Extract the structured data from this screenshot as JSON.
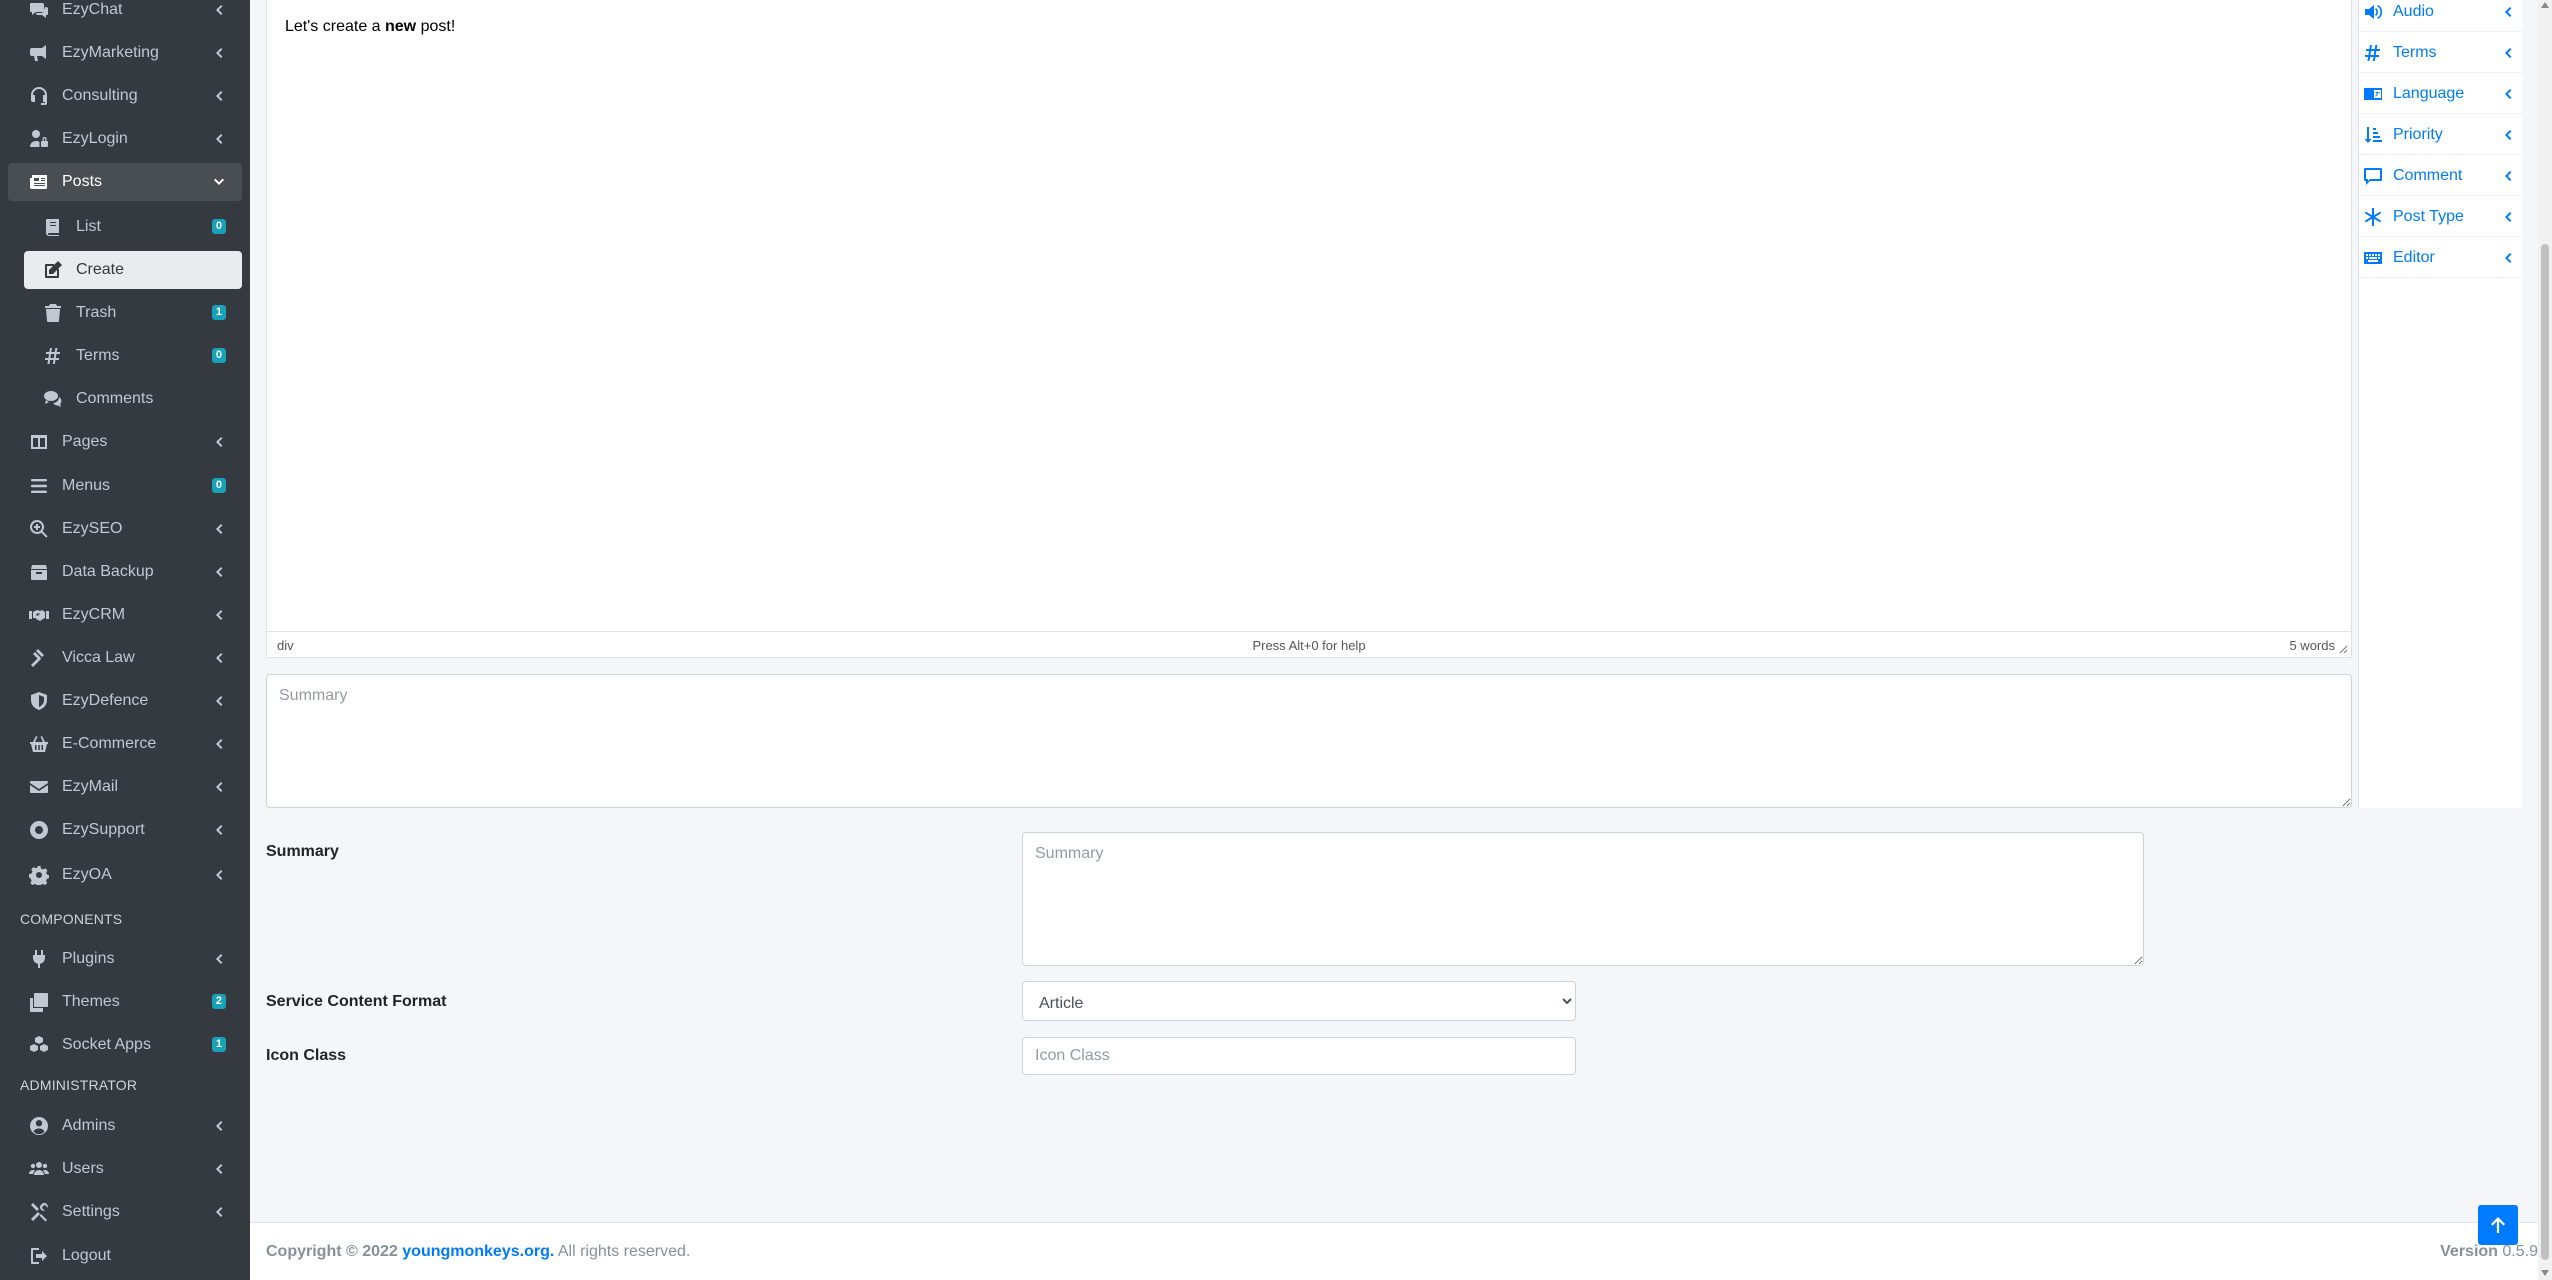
{
  "sidebar": {
    "items": [
      {
        "label": "EzyChat",
        "icon": "chat-icon"
      },
      {
        "label": "EzyMarketing",
        "icon": "bullhorn-icon"
      },
      {
        "label": "Consulting",
        "icon": "headset-icon"
      },
      {
        "label": "EzyLogin",
        "icon": "user-lock-icon"
      },
      {
        "label": "Posts",
        "icon": "newspaper-icon"
      },
      {
        "label": "List",
        "icon": "book-icon",
        "badge": "0"
      },
      {
        "label": "Create",
        "icon": "edit-icon"
      },
      {
        "label": "Trash",
        "icon": "trash-icon",
        "badge": "1"
      },
      {
        "label": "Terms",
        "icon": "hashtag-icon",
        "badge": "0"
      },
      {
        "label": "Comments",
        "icon": "comments-icon"
      },
      {
        "label": "Pages",
        "icon": "columns-icon"
      },
      {
        "label": "Menus",
        "icon": "bars-icon",
        "badge": "0"
      },
      {
        "label": "EzySEO",
        "icon": "search-plus-icon"
      },
      {
        "label": "Data Backup",
        "icon": "box-icon"
      },
      {
        "label": "EzyCRM",
        "icon": "handshake-icon"
      },
      {
        "label": "Vicca Law",
        "icon": "gavel-icon"
      },
      {
        "label": "EzyDefence",
        "icon": "shield-icon"
      },
      {
        "label": "E-Commerce",
        "icon": "basket-icon"
      },
      {
        "label": "EzyMail",
        "icon": "envelope-icon"
      },
      {
        "label": "EzySupport",
        "icon": "lifebuoy-icon"
      },
      {
        "label": "EzyOA",
        "icon": "cog-icon"
      },
      {
        "label": "Plugins",
        "icon": "plug-icon"
      },
      {
        "label": "Themes",
        "icon": "clone-icon",
        "badge": "2"
      },
      {
        "label": "Socket Apps",
        "icon": "cubes-icon",
        "badge": "1"
      },
      {
        "label": "Admins",
        "icon": "user-circle-icon"
      },
      {
        "label": "Users",
        "icon": "users-icon"
      },
      {
        "label": "Settings",
        "icon": "tools-icon"
      },
      {
        "label": "Logout",
        "icon": "sign-out-icon"
      }
    ],
    "headers": {
      "components": "COMPONENTS",
      "administrator": "ADMINISTRATOR"
    }
  },
  "editor": {
    "text_before": "Let's create a ",
    "text_bold": "new",
    "text_after": " post!",
    "status_path": "div",
    "status_help": "Press Alt+0 for help",
    "status_words": "5 words"
  },
  "main_summary": {
    "placeholder": "Summary"
  },
  "fields": {
    "summary_label": "Summary",
    "summary_placeholder": "Summary",
    "format_label": "Service Content Format",
    "format_selected": "Article",
    "icon_label": "Icon Class",
    "icon_placeholder": "Icon Class"
  },
  "right_panel": {
    "items": [
      {
        "label": "Audio",
        "icon": "volume-icon"
      },
      {
        "label": "Terms",
        "icon": "hashtag-icon"
      },
      {
        "label": "Language",
        "icon": "language-icon"
      },
      {
        "label": "Priority",
        "icon": "sort-amount-icon"
      },
      {
        "label": "Comment",
        "icon": "comment-icon"
      },
      {
        "label": "Post Type",
        "icon": "asterisk-icon"
      },
      {
        "label": "Editor",
        "icon": "keyboard-icon"
      }
    ]
  },
  "footer": {
    "copyright_prefix": "Copyright © 2022 ",
    "link": "youngmonkeys.org.",
    "suffix": " All rights reserved.",
    "version_label": "Version",
    "version_value": "0.5.9"
  },
  "colors": {
    "sidebar_bg": "#343a40",
    "accent": "#007bff",
    "badge": "#17a2b8"
  }
}
